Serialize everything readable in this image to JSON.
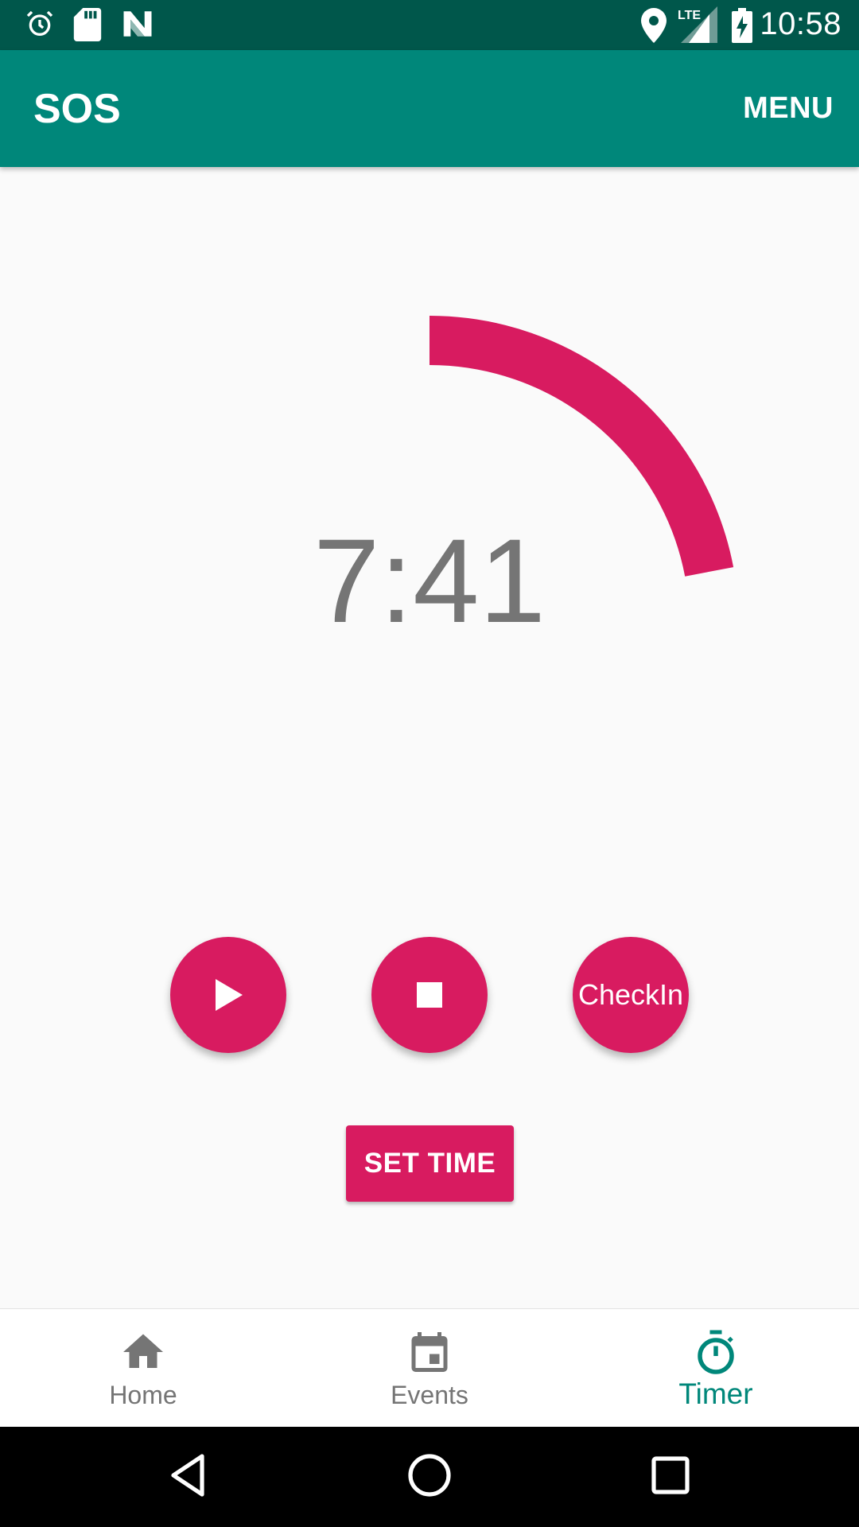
{
  "status_bar": {
    "time": "10:58",
    "network_label": "LTE",
    "icons": [
      "alarm-icon",
      "sd-card-icon",
      "n-notification-icon",
      "location-icon",
      "lte-signal-icon",
      "battery-charging-icon"
    ]
  },
  "app_bar": {
    "title": "SOS",
    "menu_label": "MENU"
  },
  "timer": {
    "display": "7:41",
    "progress_fraction": 0.22,
    "accent_color": "#d81b60"
  },
  "controls": {
    "play_icon": "play-icon",
    "stop_icon": "stop-icon",
    "checkin_label": "CheckIn",
    "set_time_label": "SET TIME"
  },
  "bottom_nav": {
    "items": [
      {
        "label": "Home",
        "icon": "home-icon",
        "active": false
      },
      {
        "label": "Events",
        "icon": "calendar-icon",
        "active": false
      },
      {
        "label": "Timer",
        "icon": "stopwatch-icon",
        "active": true
      }
    ],
    "active_color": "#00877a"
  },
  "system_nav": {
    "buttons": [
      "back-icon",
      "home-circle-icon",
      "recents-icon"
    ]
  },
  "colors": {
    "status_bar": "#00574b",
    "app_bar": "#00877a",
    "accent": "#d81b60",
    "background": "#fafafa"
  }
}
